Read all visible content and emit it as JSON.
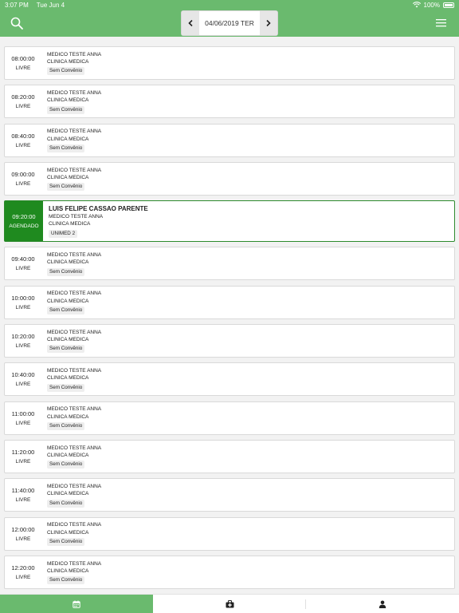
{
  "status_bar": {
    "time": "3:07 PM",
    "date": "Tue Jun 4",
    "battery": "100%"
  },
  "header": {
    "date_label": "04/06/2019 TER"
  },
  "slots": [
    {
      "time": "08:00:00",
      "status": "LIVRE",
      "patient": "",
      "doctor": "MEDICO TESTE ANNA",
      "specialty": "CLINICA MEDICA",
      "insurance": "Sem Convênio"
    },
    {
      "time": "08:20:00",
      "status": "LIVRE",
      "patient": "",
      "doctor": "MEDICO TESTE ANNA",
      "specialty": "CLINICA MEDICA",
      "insurance": "Sem Convênio"
    },
    {
      "time": "08:40:00",
      "status": "LIVRE",
      "patient": "",
      "doctor": "MEDICO TESTE ANNA",
      "specialty": "CLINICA MEDICA",
      "insurance": "Sem Convênio"
    },
    {
      "time": "09:00:00",
      "status": "LIVRE",
      "patient": "",
      "doctor": "MEDICO TESTE ANNA",
      "specialty": "CLINICA MEDICA",
      "insurance": "Sem Convênio"
    },
    {
      "time": "09:20:00",
      "status": "AGENDADO",
      "patient": "LUIS FELIPE CASSAO PARENTE",
      "doctor": "MEDICO TESTE ANNA",
      "specialty": "CLINICA MEDICA",
      "insurance": "UNIMED 2"
    },
    {
      "time": "09:40:00",
      "status": "LIVRE",
      "patient": "",
      "doctor": "MEDICO TESTE ANNA",
      "specialty": "CLINICA MEDICA",
      "insurance": "Sem Convênio"
    },
    {
      "time": "10:00:00",
      "status": "LIVRE",
      "patient": "",
      "doctor": "MEDICO TESTE ANNA",
      "specialty": "CLINICA MEDICA",
      "insurance": "Sem Convênio"
    },
    {
      "time": "10:20:00",
      "status": "LIVRE",
      "patient": "",
      "doctor": "MEDICO TESTE ANNA",
      "specialty": "CLINICA MEDICA",
      "insurance": "Sem Convênio"
    },
    {
      "time": "10:40:00",
      "status": "LIVRE",
      "patient": "",
      "doctor": "MEDICO TESTE ANNA",
      "specialty": "CLINICA MEDICA",
      "insurance": "Sem Convênio"
    },
    {
      "time": "11:00:00",
      "status": "LIVRE",
      "patient": "",
      "doctor": "MEDICO TESTE ANNA",
      "specialty": "CLINICA MEDICA",
      "insurance": "Sem Convênio"
    },
    {
      "time": "11:20:00",
      "status": "LIVRE",
      "patient": "",
      "doctor": "MEDICO TESTE ANNA",
      "specialty": "CLINICA MEDICA",
      "insurance": "Sem Convênio"
    },
    {
      "time": "11:40:00",
      "status": "LIVRE",
      "patient": "",
      "doctor": "MEDICO TESTE ANNA",
      "specialty": "CLINICA MEDICA",
      "insurance": "Sem Convênio"
    },
    {
      "time": "12:00:00",
      "status": "LIVRE",
      "patient": "",
      "doctor": "MEDICO TESTE ANNA",
      "specialty": "CLINICA MEDICA",
      "insurance": "Sem Convênio"
    },
    {
      "time": "12:20:00",
      "status": "LIVRE",
      "patient": "",
      "doctor": "MEDICO TESTE ANNA",
      "specialty": "CLINICA MEDICA",
      "insurance": "Sem Convênio"
    }
  ],
  "tabs": [
    {
      "icon": "calendar-icon",
      "active": true
    },
    {
      "icon": "medical-kit-icon",
      "active": false
    },
    {
      "icon": "user-icon",
      "active": false
    }
  ],
  "colors": {
    "primary": "#6aba6e",
    "booked": "#1f8a1f"
  }
}
